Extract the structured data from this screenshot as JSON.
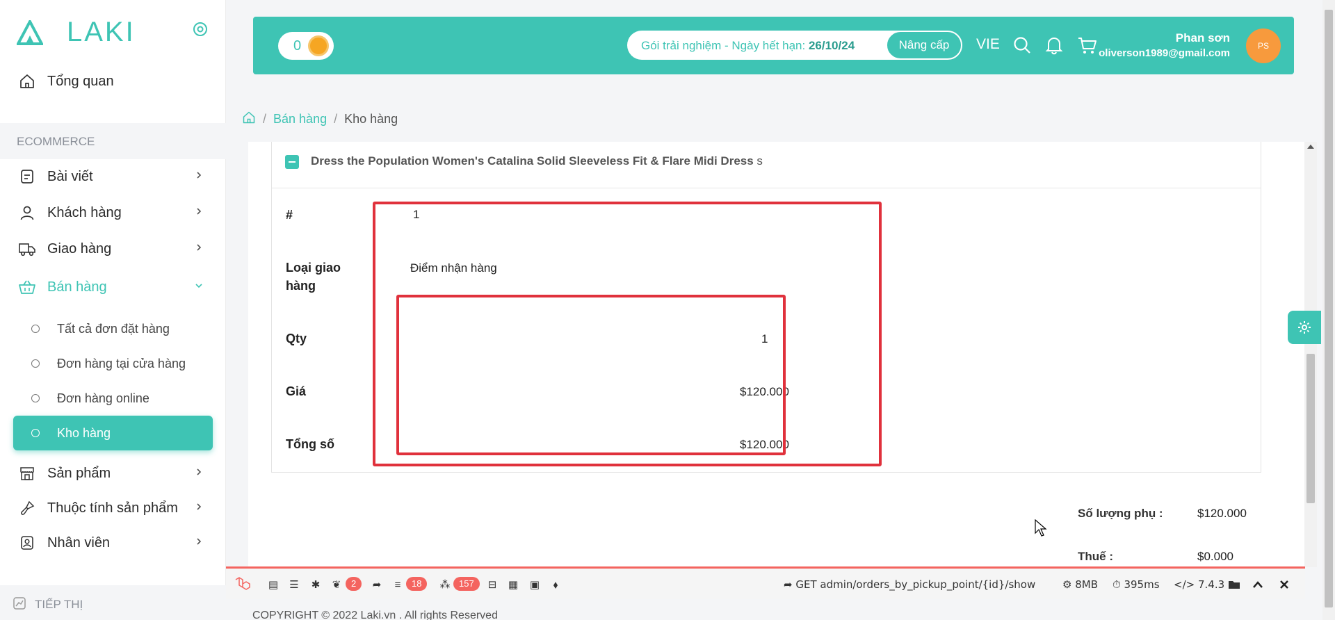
{
  "brand": {
    "name": "LAKI"
  },
  "sidebar": {
    "overview": "Tổng quan",
    "section": "ECOMMERCE",
    "items": [
      {
        "label": "Bài viết"
      },
      {
        "label": "Khách hàng"
      },
      {
        "label": "Giao hàng"
      },
      {
        "label": "Bán hàng"
      }
    ],
    "sub_items": [
      {
        "label": "Tất cả đơn đặt hàng"
      },
      {
        "label": "Đơn hàng tại cửa hàng"
      },
      {
        "label": "Đơn hàng online"
      },
      {
        "label": "Kho hàng"
      }
    ],
    "items2": [
      {
        "label": "Sản phẩm"
      },
      {
        "label": "Thuộc tính sản phẩm"
      },
      {
        "label": "Nhân viên"
      }
    ],
    "bottom_section": "TIẾP THỊ"
  },
  "header": {
    "coins": "0",
    "trial_label": "Gói trải nghiệm  -  Ngày hết hạn:",
    "expiry_date": "26/10/24",
    "upgrade_label": "Nâng cấp",
    "language": "VIE",
    "user_name": "Phan sơn",
    "user_email": "oliverson1989@gmail.com",
    "avatar_initials": "PS"
  },
  "breadcrumb": {
    "items": [
      "Bán hàng",
      "Kho hàng"
    ]
  },
  "product": {
    "title": "Dress the Population Women's Catalina Solid Sleeveless Fit & Flare Midi Dress",
    "title_suffix": "s",
    "rows": {
      "index_label": "#",
      "index_value": "1",
      "delivery_label": "Loại giao hàng",
      "delivery_value": "Điểm nhận hàng",
      "qty_label": "Qty",
      "qty_value": "1",
      "price_label": "Giá",
      "price_value": "$120.000",
      "total_label": "Tổng số",
      "total_value": "$120.000"
    }
  },
  "summary": {
    "subtotal_label": "Số lượng phụ :",
    "subtotal_value": "$120.000",
    "tax_label": "Thuế :",
    "tax_value": "$0.000"
  },
  "debugbar": {
    "badge_views": "2",
    "badge_queries": "18",
    "badge_models": "157",
    "route": "GET admin/orders_by_pickup_point/{id}/show",
    "memory": "8MB",
    "time": "395ms",
    "php_version": "7.4.3"
  },
  "footer": {
    "copyright": "COPYRIGHT © 2022 Laki.vn . All rights Reserved"
  },
  "colors": {
    "accent": "#3ec4b4",
    "highlight": "#e0313c",
    "avatar": "#f79a3d"
  }
}
